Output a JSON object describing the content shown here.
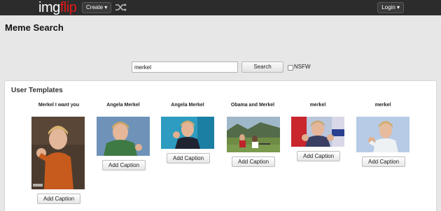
{
  "topbar": {
    "logo_part1": "img",
    "logo_part2": "flip",
    "create_label": "Create ▾",
    "shuffle_icon": "shuffle-icon",
    "login_label": "Login ▾"
  },
  "page": {
    "title": "Meme Search"
  },
  "search": {
    "value": "merkel",
    "button_label": "Search",
    "nsfw_label": "NSFW",
    "nsfw_checked": false
  },
  "templates_section": {
    "title": "User Templates",
    "items": [
      {
        "name": "Merkel I want you",
        "button": "Add Caption"
      },
      {
        "name": "Angela Merkel",
        "button": "Add Caption"
      },
      {
        "name": "Angela Merkel",
        "button": "Add Caption"
      },
      {
        "name": "Obama and Merkel",
        "button": "Add Caption"
      },
      {
        "name": "merkel",
        "button": "Add Caption"
      },
      {
        "name": "merkel",
        "button": "Add Caption"
      }
    ]
  },
  "colors": {
    "topbar_bg": "#2c2c2c",
    "logo_red": "#e21a1a",
    "page_bg": "#e7e7e7"
  }
}
